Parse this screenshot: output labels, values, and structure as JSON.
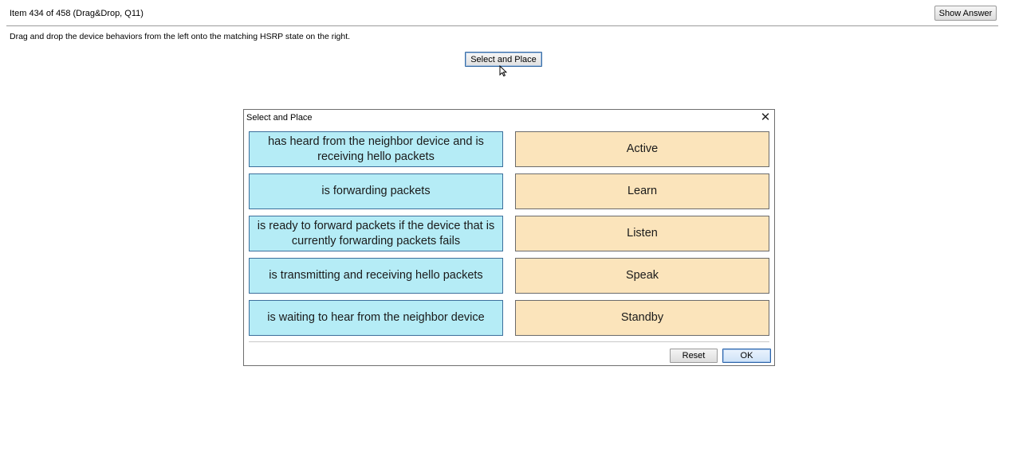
{
  "header": {
    "item_counter": "Item 434 of 458  (Drag&Drop, Q11)",
    "show_answer_label": "Show Answer"
  },
  "instruction": "Drag and drop the device behaviors from the left onto the matching HSRP state on the right.",
  "open_button_label": "Select and Place",
  "dialog": {
    "title": "Select and Place",
    "close_symbol": "✕",
    "behaviors": [
      {
        "label": "has heard from the neighbor device and is receiving hello packets"
      },
      {
        "label": "is forwarding packets"
      },
      {
        "label": "is ready to forward packets if the device that is currently forwarding packets fails"
      },
      {
        "label": "is transmitting and receiving hello packets"
      },
      {
        "label": "is waiting to hear from the neighbor device"
      }
    ],
    "states": [
      {
        "label": "Active"
      },
      {
        "label": "Learn"
      },
      {
        "label": "Listen"
      },
      {
        "label": "Speak"
      },
      {
        "label": "Standby"
      }
    ],
    "reset_label": "Reset",
    "ok_label": "OK"
  },
  "colors": {
    "behavior_tile": "#b5ecf6",
    "state_tile": "#fbe4bb",
    "ok_border": "#2a62a8"
  },
  "icons": {
    "close": "close-icon",
    "cursor": "mouse-pointer-icon"
  }
}
